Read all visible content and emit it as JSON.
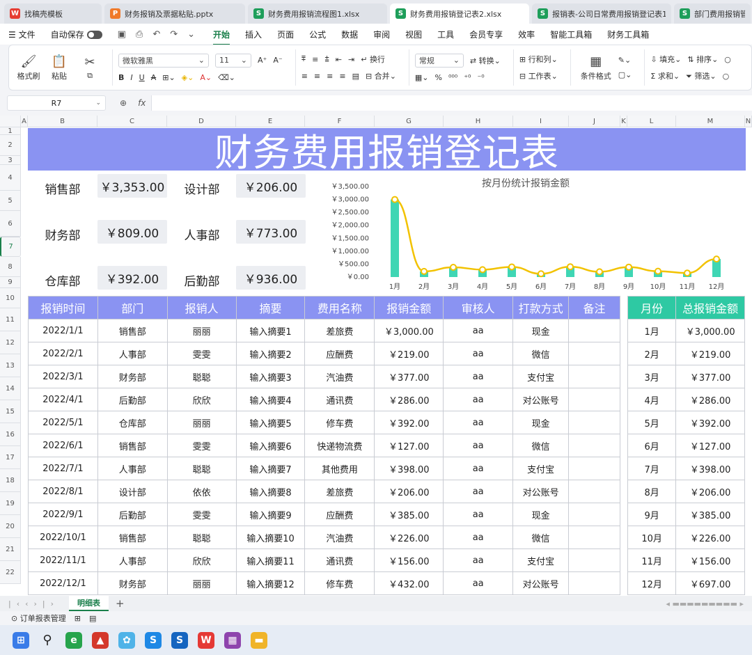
{
  "tabs": [
    {
      "icon": "W",
      "kind": "w",
      "label": "找稿壳模板"
    },
    {
      "icon": "P",
      "kind": "p",
      "label": "财务报销及票据粘贴.pptx"
    },
    {
      "icon": "S",
      "kind": "s",
      "label": "财务费用报销流程图1.xlsx"
    },
    {
      "icon": "S",
      "kind": "s",
      "label": "财务费用报销登记表2.xlsx",
      "active": true
    },
    {
      "icon": "S",
      "kind": "s",
      "label": "报销表-公司日常费用报销登记表1"
    },
    {
      "icon": "S",
      "kind": "s",
      "label": "部门费用报销管理"
    }
  ],
  "menu": {
    "file": "文件",
    "autosave": "自动保存",
    "items": [
      "开始",
      "插入",
      "页面",
      "公式",
      "数据",
      "审阅",
      "视图",
      "工具",
      "会员专享",
      "效率",
      "智能工具箱",
      "财务工具箱"
    ]
  },
  "ribbon": {
    "format_painter": "格式刷",
    "paste": "粘贴",
    "font_name": "微软雅黑",
    "font_size": "11",
    "wrap": "换行",
    "merge": "合并",
    "number_format": "常规",
    "convert": "转换",
    "row_col": "行和列",
    "worksheet": "工作表",
    "cond_format": "条件格式",
    "fill": "填充",
    "sort": "排序",
    "sum": "求和",
    "filter": "筛选"
  },
  "formula_bar": {
    "cell": "R7",
    "fx": "fx"
  },
  "columns": [
    "A",
    "B",
    "C",
    "D",
    "E",
    "F",
    "G",
    "H",
    "I",
    "J",
    "K",
    "L",
    "M",
    "N"
  ],
  "rows": [
    "1",
    "2",
    "3",
    "4",
    "5",
    "6",
    "7",
    "8",
    "9",
    "10",
    "11",
    "12",
    "13",
    "14",
    "15",
    "16",
    "17",
    "18",
    "19",
    "20",
    "21",
    "22"
  ],
  "title": "财务费用报销登记表",
  "summary": [
    {
      "dept": "销售部",
      "amount": "￥3,353.00"
    },
    {
      "dept": "设计部",
      "amount": "￥206.00"
    },
    {
      "dept": "财务部",
      "amount": "￥809.00"
    },
    {
      "dept": "人事部",
      "amount": "￥773.00"
    },
    {
      "dept": "仓库部",
      "amount": "￥392.00"
    },
    {
      "dept": "后勤部",
      "amount": "￥936.00"
    }
  ],
  "chart_data": {
    "type": "bar",
    "title": "按月份统计报销金额",
    "categories": [
      "1月",
      "2月",
      "3月",
      "4月",
      "5月",
      "6月",
      "7月",
      "8月",
      "9月",
      "10月",
      "11月",
      "12月"
    ],
    "values": [
      3000,
      219,
      377,
      286,
      392,
      127,
      398,
      206,
      385,
      226,
      156,
      697
    ],
    "ylim": [
      0,
      3500
    ],
    "yticks": [
      "￥0.00",
      "￥500.00",
      "￥1,000.00",
      "￥1,500.00",
      "￥2,000.00",
      "￥2,500.00",
      "￥3,000.00",
      "￥3,500.00"
    ],
    "bar_color": "#3fd6b4",
    "line_color": "#f2c200",
    "grid": false
  },
  "detail": {
    "headers": [
      "报销时间",
      "部门",
      "报销人",
      "摘要",
      "费用名称",
      "报销金额",
      "审核人",
      "打款方式",
      "备注"
    ],
    "rows": [
      [
        "2022/1/1",
        "销售部",
        "丽丽",
        "输入摘要1",
        "差旅费",
        "￥3,000.00",
        "aa",
        "现金",
        ""
      ],
      [
        "2022/2/1",
        "人事部",
        "雯雯",
        "输入摘要2",
        "应酬费",
        "￥219.00",
        "aa",
        "微信",
        ""
      ],
      [
        "2022/3/1",
        "财务部",
        "聪聪",
        "输入摘要3",
        "汽油费",
        "￥377.00",
        "aa",
        "支付宝",
        ""
      ],
      [
        "2022/4/1",
        "后勤部",
        "欣欣",
        "输入摘要4",
        "通讯费",
        "￥286.00",
        "aa",
        "对公账号",
        ""
      ],
      [
        "2022/5/1",
        "仓库部",
        "丽丽",
        "输入摘要5",
        "修车费",
        "￥392.00",
        "aa",
        "现金",
        ""
      ],
      [
        "2022/6/1",
        "销售部",
        "雯雯",
        "输入摘要6",
        "快递物流费",
        "￥127.00",
        "aa",
        "微信",
        ""
      ],
      [
        "2022/7/1",
        "人事部",
        "聪聪",
        "输入摘要7",
        "其他费用",
        "￥398.00",
        "aa",
        "支付宝",
        ""
      ],
      [
        "2022/8/1",
        "设计部",
        "依依",
        "输入摘要8",
        "差旅费",
        "￥206.00",
        "aa",
        "对公账号",
        ""
      ],
      [
        "2022/9/1",
        "后勤部",
        "雯雯",
        "输入摘要9",
        "应酬费",
        "￥385.00",
        "aa",
        "现金",
        ""
      ],
      [
        "2022/10/1",
        "销售部",
        "聪聪",
        "输入摘要10",
        "汽油费",
        "￥226.00",
        "aa",
        "微信",
        ""
      ],
      [
        "2022/11/1",
        "人事部",
        "欣欣",
        "输入摘要11",
        "通讯费",
        "￥156.00",
        "aa",
        "支付宝",
        ""
      ],
      [
        "2022/12/1",
        "财务部",
        "丽丽",
        "输入摘要12",
        "修车费",
        "￥432.00",
        "aa",
        "对公账号",
        ""
      ]
    ]
  },
  "monthly": {
    "headers": [
      "月份",
      "总报销金额"
    ],
    "rows": [
      [
        "1月",
        "￥3,000.00"
      ],
      [
        "2月",
        "￥219.00"
      ],
      [
        "3月",
        "￥377.00"
      ],
      [
        "4月",
        "￥286.00"
      ],
      [
        "5月",
        "￥392.00"
      ],
      [
        "6月",
        "￥127.00"
      ],
      [
        "7月",
        "￥398.00"
      ],
      [
        "8月",
        "￥206.00"
      ],
      [
        "9月",
        "￥385.00"
      ],
      [
        "10月",
        "￥226.00"
      ],
      [
        "11月",
        "￥156.00"
      ],
      [
        "12月",
        "￥697.00"
      ]
    ]
  },
  "sheet_tab": "明细表",
  "status": {
    "item1": "订单报表管理"
  }
}
